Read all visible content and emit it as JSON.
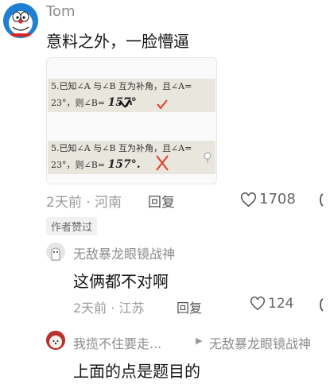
{
  "main_comment": {
    "username": "Tom",
    "text": "意料之外，一脸懵逼",
    "time_location": "2天前 · 河南",
    "reply_label": "回复",
    "like_count": "1708",
    "author_badge": "作者赞过",
    "image": {
      "problem_line1": "5.已知∠A 与∠B 互为补角，且∠A=",
      "problem_line2_prefix": "23°，则∠B=",
      "answer_top": "157°",
      "answer_bottom": "157°."
    }
  },
  "replies": [
    {
      "username": "无敌暴龙眼镜战神",
      "text": "这俩都不对啊",
      "time_location": "2天前 · 江苏",
      "reply_label": "回复",
      "like_count": "124"
    },
    {
      "username": "我揽不住要走...",
      "reply_to": "无敌暴龙眼镜战神",
      "text": "上面的点是题目的"
    }
  ],
  "colors": {
    "check": "#e23b2e",
    "text": "#161616",
    "meta": "#9a9a9a"
  }
}
